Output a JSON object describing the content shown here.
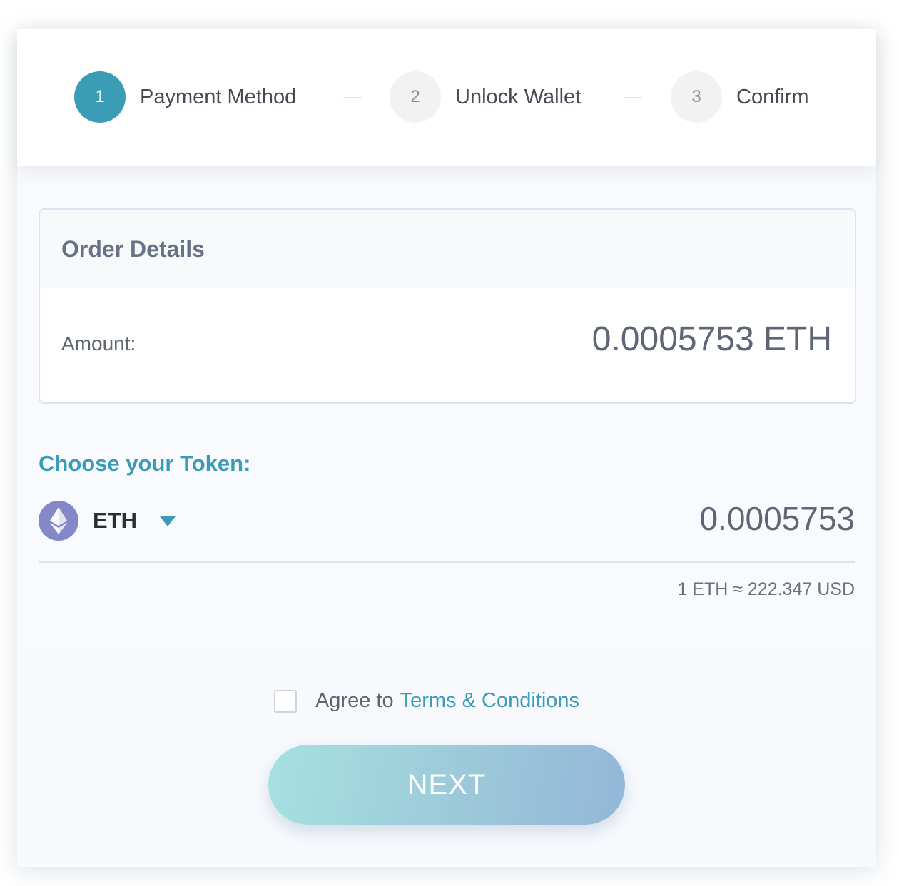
{
  "stepper": {
    "steps": [
      {
        "number": "1",
        "label": "Payment Method",
        "active": true
      },
      {
        "number": "2",
        "label": "Unlock Wallet",
        "active": false
      },
      {
        "number": "3",
        "label": "Confirm",
        "active": false
      }
    ]
  },
  "order": {
    "title": "Order Details",
    "amount_label": "Amount:",
    "amount_value": "0.0005753 ETH"
  },
  "token": {
    "choose_label": "Choose your Token:",
    "selected_symbol": "ETH",
    "icon": "ethereum-icon",
    "amount": "0.0005753",
    "rate": "1 ETH ≈ 222.347 USD"
  },
  "footer": {
    "agree_prefix": "Agree to",
    "terms_link": "Terms & Conditions",
    "agree_checked": false,
    "next_label": "NEXT"
  },
  "colors": {
    "accent": "#3a9cb5",
    "eth_coin": "#8488c8",
    "text_dark": "#454a55"
  }
}
